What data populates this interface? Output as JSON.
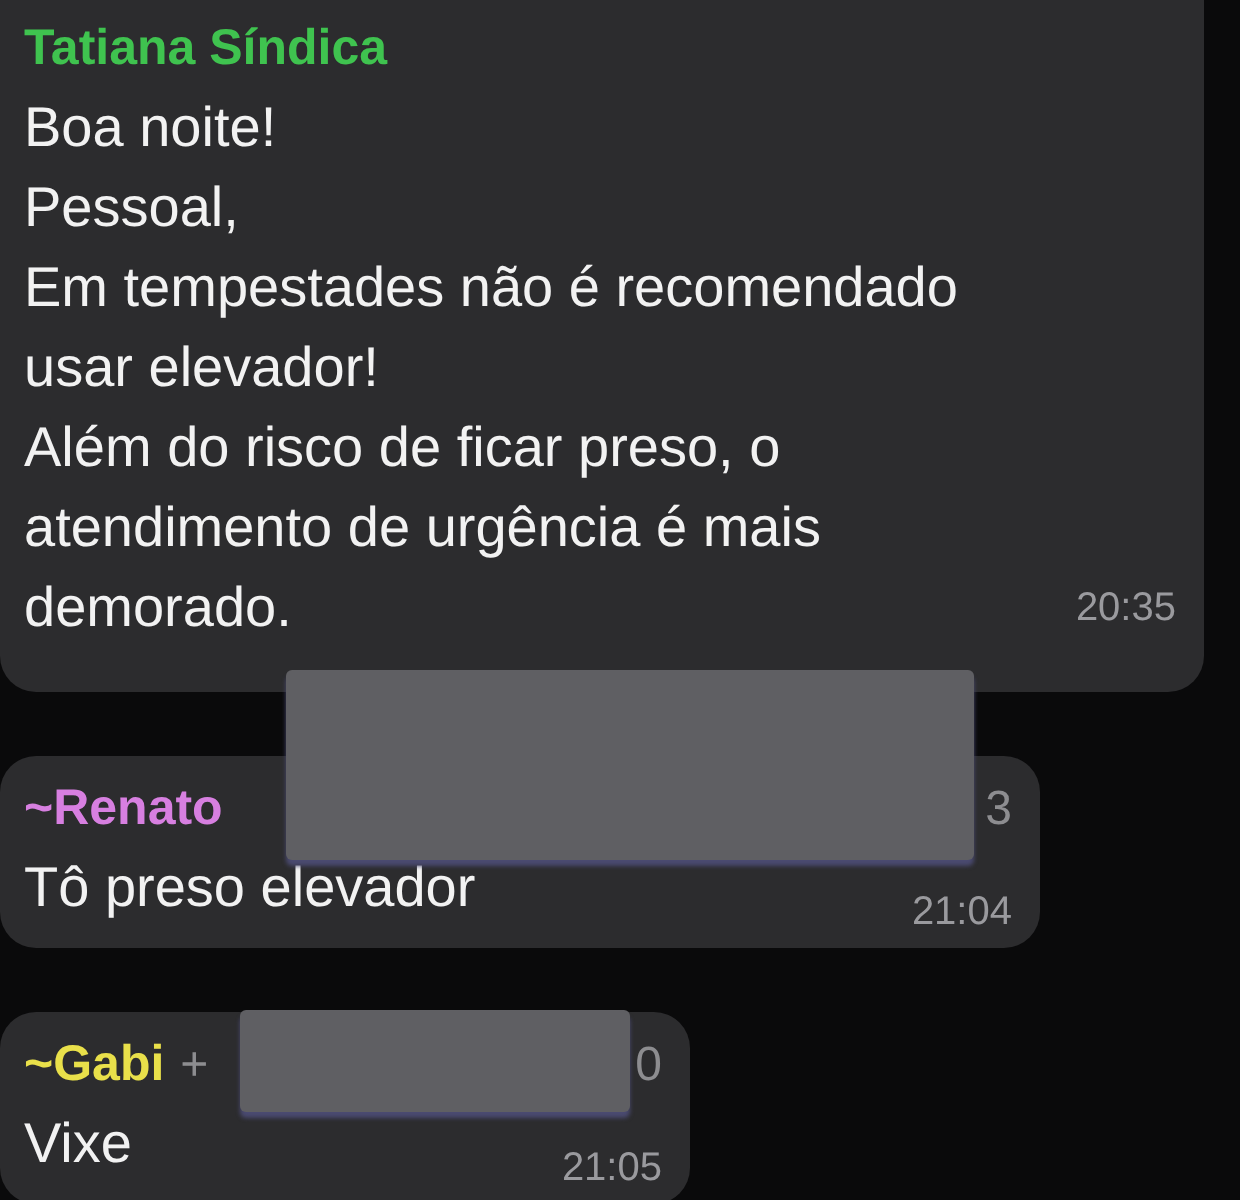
{
  "messages": [
    {
      "sender": "Tatiana Síndica",
      "color": "#3fc34f",
      "lines": [
        "Boa noite!",
        "Pessoal,",
        "Em tempestades não é recomendado",
        "usar elevador!",
        "Além do risco de ficar preso, o",
        "atendimento de urgência é mais",
        "demorado."
      ],
      "time": "20:35",
      "redacted": false
    },
    {
      "sender": "~Renato",
      "color": "#d77fe0",
      "phone_end": "3",
      "redacted": true,
      "lines": [
        "Tô preso elevador"
      ],
      "time": "21:04"
    },
    {
      "sender": "~Gabi",
      "color": "#e9e04a",
      "phone_start": "+",
      "phone_end": "0",
      "redacted": true,
      "lines": [
        "Vixe"
      ],
      "time": "21:05"
    }
  ]
}
